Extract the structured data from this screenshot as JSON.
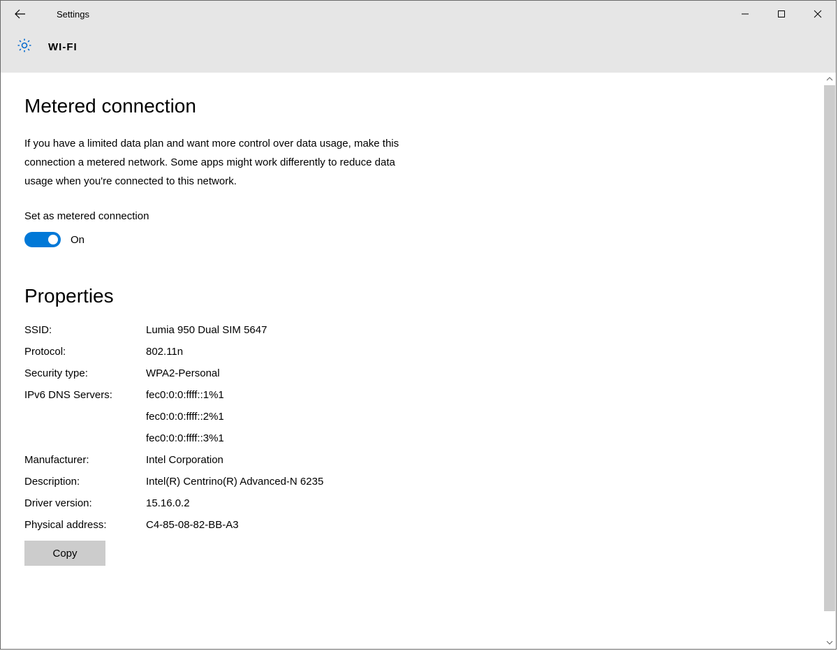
{
  "titlebar": {
    "title": "Settings"
  },
  "page": {
    "title": "WI-FI"
  },
  "metered": {
    "heading": "Metered connection",
    "description": "If you have a limited data plan and want more control over data usage, make this connection a metered network. Some apps might work differently to reduce data usage when you're connected to this network.",
    "switch_label": "Set as metered connection",
    "switch_state": "On"
  },
  "properties": {
    "heading": "Properties",
    "ssid_label": "SSID:",
    "ssid_value": "Lumia 950 Dual SIM 5647",
    "protocol_label": "Protocol:",
    "protocol_value": "802.11n",
    "security_label": "Security type:",
    "security_value": "WPA2-Personal",
    "dns_label": "IPv6 DNS Servers:",
    "dns1": "fec0:0:0:ffff::1%1",
    "dns2": "fec0:0:0:ffff::2%1",
    "dns3": "fec0:0:0:ffff::3%1",
    "manufacturer_label": "Manufacturer:",
    "manufacturer_value": "Intel Corporation",
    "description_label": "Description:",
    "description_value": "Intel(R) Centrino(R) Advanced-N 6235",
    "driver_label": "Driver version:",
    "driver_value": "15.16.0.2",
    "mac_label": "Physical address:",
    "mac_value": "C4-85-08-82-BB-A3",
    "copy_label": "Copy"
  }
}
